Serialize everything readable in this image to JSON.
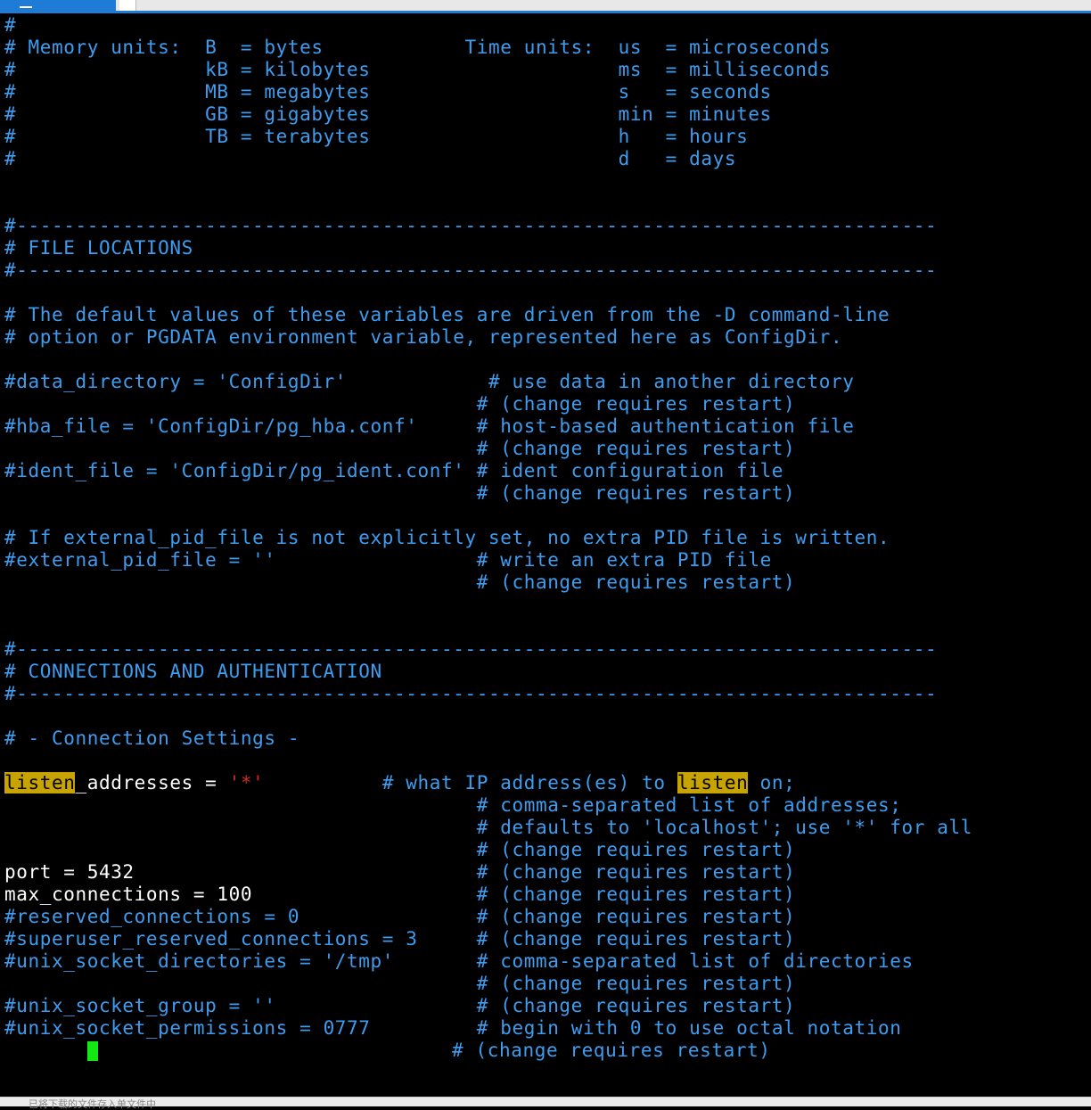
{
  "colors": {
    "background": "#000000",
    "comment": "#3d9df0",
    "text": "#ffffff",
    "string": "#cc2b2b",
    "search_highlight": "#c8a400",
    "cursor": "#14e814",
    "tab_accent": "#1e7bd6"
  },
  "terminal": {
    "lines": [
      "#",
      "# Memory units:  B  = bytes            Time units:  us  = microseconds",
      "#                kB = kilobytes                     ms  = milliseconds",
      "#                MB = megabytes                     s   = seconds",
      "#                GB = gigabytes                     min = minutes",
      "#                TB = terabytes                     h   = hours",
      "#                                                   d   = days",
      "",
      "",
      "#------------------------------------------------------------------------------",
      "# FILE LOCATIONS",
      "#------------------------------------------------------------------------------",
      "",
      "# The default values of these variables are driven from the -D command-line",
      "# option or PGDATA environment variable, represented here as ConfigDir.",
      "",
      {
        "setting": "#data_directory = 'ConfigDir'",
        "pad": "            ",
        "comment": "# use data in another directory"
      },
      {
        "setting": "",
        "pad": "                                        ",
        "comment": "# (change requires restart)"
      },
      {
        "setting": "#hba_file = 'ConfigDir/pg_hba.conf'",
        "pad": "     ",
        "comment": "# host-based authentication file"
      },
      {
        "setting": "",
        "pad": "                                        ",
        "comment": "# (change requires restart)"
      },
      {
        "setting": "#ident_file = 'ConfigDir/pg_ident.conf'",
        "pad": " ",
        "comment": "# ident configuration file"
      },
      {
        "setting": "",
        "pad": "                                        ",
        "comment": "# (change requires restart)"
      },
      "",
      "# If external_pid_file is not explicitly set, no extra PID file is written.",
      {
        "setting": "#external_pid_file = ''",
        "pad": "                 ",
        "comment": "# write an extra PID file"
      },
      {
        "setting": "",
        "pad": "                                        ",
        "comment": "# (change requires restart)"
      },
      "",
      "",
      "#------------------------------------------------------------------------------",
      "# CONNECTIONS AND AUTHENTICATION",
      "#------------------------------------------------------------------------------",
      "",
      "# - Connection Settings -",
      ""
    ],
    "listen_line": {
      "keyword_match": "listen",
      "rest": "_addresses = ",
      "value": "'*'",
      "pad": "          ",
      "comment_pre": "# what IP address(es) to ",
      "comment_match": "listen",
      "comment_post": " on;"
    },
    "lines2": [
      {
        "setting": "",
        "pad": "                                        ",
        "comment": "# comma-separated list of addresses;"
      },
      {
        "setting": "",
        "pad": "                                        ",
        "comment": "# defaults to 'localhost'; use '*' for all"
      },
      {
        "setting": "",
        "pad": "                                        ",
        "comment": "# (change requires restart)"
      },
      {
        "setting": "port = 5432",
        "pad": "                             ",
        "comment": "# (change requires restart)",
        "active": true
      },
      {
        "setting": "max_connections = 100",
        "pad": "                   ",
        "comment": "# (change requires restart)",
        "active": true
      },
      {
        "setting": "#reserved_connections = 0",
        "pad": "               ",
        "comment": "# (change requires restart)"
      },
      {
        "setting": "#superuser_reserved_connections = 3",
        "pad": "     ",
        "comment": "# (change requires restart)"
      },
      {
        "setting": "#unix_socket_directories = '/tmp'",
        "pad": "       ",
        "comment": "# comma-separated list of directories"
      },
      {
        "setting": "",
        "pad": "                                        ",
        "comment": "# (change requires restart)"
      },
      {
        "setting": "#unix_socket_group = ''",
        "pad": "                 ",
        "comment": "# (change requires restart)"
      },
      {
        "setting": "#unix_socket_permissions = 0777",
        "pad": "         ",
        "comment": "# begin with 0 to use octal notation"
      }
    ],
    "cursor_line": {
      "indent": "       ",
      "pad": "                              ",
      "comment": "# (change requires restart)"
    }
  },
  "status_hint": "已将下载的文件存入单文件中"
}
